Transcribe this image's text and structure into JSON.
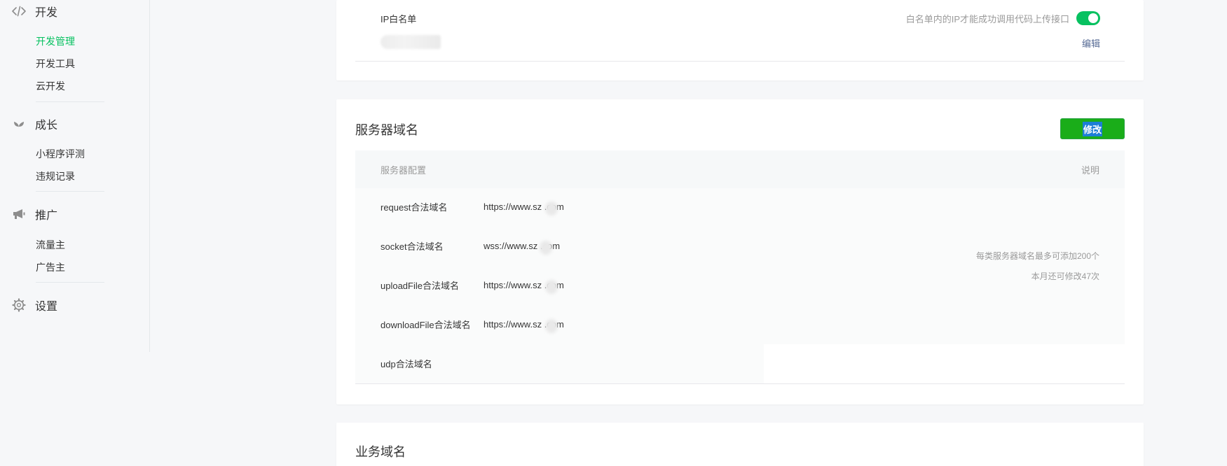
{
  "sidebar": {
    "dev": {
      "label": "开发",
      "icon": "code-icon",
      "items": [
        {
          "label": "开发管理",
          "active": true
        },
        {
          "label": "开发工具",
          "active": false
        },
        {
          "label": "云开发",
          "active": false
        }
      ]
    },
    "growth": {
      "label": "成长",
      "icon": "sprout-icon",
      "items": [
        {
          "label": "小程序评测"
        },
        {
          "label": "违规记录"
        }
      ]
    },
    "promo": {
      "label": "推广",
      "icon": "megaphone-icon",
      "items": [
        {
          "label": "流量主"
        },
        {
          "label": "广告主"
        }
      ]
    },
    "settings": {
      "label": "设置",
      "icon": "gear-icon"
    }
  },
  "whitelist": {
    "label": "IP白名单",
    "tip": "白名单内的IP才能成功调用代码上传接口",
    "enabled": true,
    "edit_label": "编辑"
  },
  "server_domain": {
    "title": "服务器域名",
    "modify_label": "修改",
    "table": {
      "col_config": "服务器配置",
      "col_desc": "说明",
      "rows": [
        {
          "name": "request合法域名",
          "value": "https://www.sz   .com"
        },
        {
          "name": "socket合法域名",
          "value": "wss://www.sz   .com"
        },
        {
          "name": "uploadFile合法域名",
          "value": "https://www.sz   .com"
        },
        {
          "name": "downloadFile合法域名",
          "value": "https://www.sz   .com"
        },
        {
          "name": "udp合法域名",
          "value": ""
        }
      ],
      "note_line1": "每类服务器域名最多可添加200个",
      "note_line2": "本月还可修改47次"
    }
  },
  "business_domain": {
    "title": "业务域名"
  },
  "colors": {
    "accent": "#07c160",
    "button": "#1aad19",
    "link": "#576b95"
  }
}
